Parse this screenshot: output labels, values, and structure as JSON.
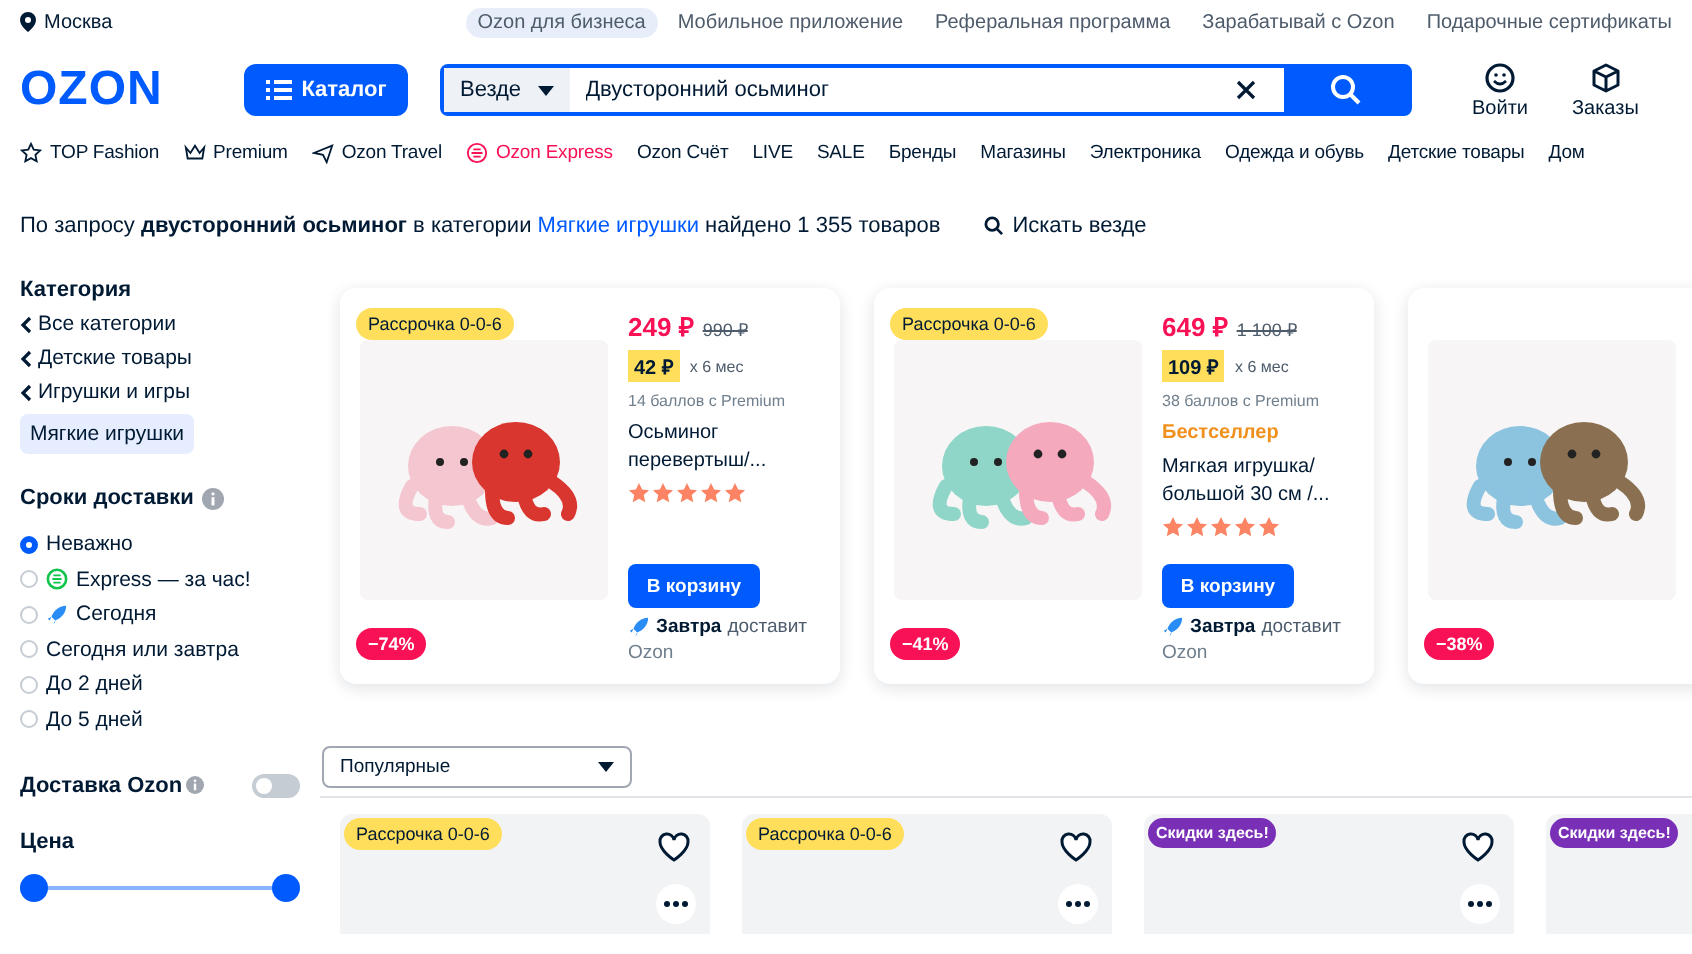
{
  "top_bar": {
    "location": "Москва",
    "links": [
      {
        "label": "Ozon для бизнеса",
        "highlighted": true
      },
      {
        "label": "Мобильное приложение",
        "highlighted": false
      },
      {
        "label": "Реферальная программа",
        "highlighted": false
      },
      {
        "label": "Зарабатывай с Ozon",
        "highlighted": false
      },
      {
        "label": "Подарочные сертификаты",
        "highlighted": false
      }
    ]
  },
  "header": {
    "logo": "OZON",
    "catalog_button": "Каталог",
    "search": {
      "scope": "Везде",
      "value": "Двусторонний осьминог"
    },
    "actions": [
      {
        "kind": "face",
        "label": "Войти"
      },
      {
        "kind": "box",
        "label": "Заказы"
      }
    ]
  },
  "nav": [
    {
      "label": "TOP Fashion",
      "kind": "star"
    },
    {
      "label": "Premium",
      "kind": "crown"
    },
    {
      "label": "Ozon Travel",
      "kind": "plane"
    },
    {
      "label": "Ozon Express",
      "kind": "express"
    },
    {
      "label": "Ozon Счёт",
      "kind": "plain"
    },
    {
      "label": "LIVE",
      "kind": "plain"
    },
    {
      "label": "SALE",
      "kind": "plain"
    },
    {
      "label": "Бренды",
      "kind": "plain"
    },
    {
      "label": "Магазины",
      "kind": "plain"
    },
    {
      "label": "Электроника",
      "kind": "plain"
    },
    {
      "label": "Одежда и обувь",
      "kind": "plain"
    },
    {
      "label": "Детские товары",
      "kind": "plain"
    },
    {
      "label": "Дом",
      "kind": "plain"
    }
  ],
  "query": {
    "prefix": "По запросу **двусторонний осьминог** в категории",
    "link": "Мягкие игрушки",
    "suffix": "найдено 1 355 товаров",
    "search_everywhere": "Искать везде"
  },
  "sidebar": {
    "category_title": "Категория",
    "categories": [
      {
        "label": "Все категории",
        "selected": false
      },
      {
        "label": "Детские товары",
        "selected": false
      },
      {
        "label": "Игрушки и игры",
        "selected": false
      },
      {
        "label": "Мягкие игрушки",
        "selected": true
      }
    ],
    "delivery_title": "Сроки доставки",
    "delivery_options": [
      {
        "label": "Неважно",
        "kind": "plain",
        "selected": true
      },
      {
        "label": "Express — за час!",
        "kind": "express",
        "selected": false
      },
      {
        "label": "Сегодня",
        "kind": "rocket",
        "selected": false
      },
      {
        "label": "Сегодня или завтра",
        "kind": "plain",
        "selected": false
      },
      {
        "label": "До 2 дней",
        "kind": "plain",
        "selected": false
      },
      {
        "label": "До 5 дней",
        "kind": "plain",
        "selected": false
      }
    ],
    "ozon_delivery": {
      "label": "Доставка Ozon",
      "on": false
    },
    "price": {
      "title": "Цена",
      "level": 1
    }
  },
  "products": [
    {
      "badge": "Рассрочка 0-0-6",
      "price": "249 ₽",
      "old_price": "990 ₽",
      "installment": "42 ₽",
      "installment_term": "x 6 мес",
      "points": "14 баллов с Premium",
      "title": "Осьминог перевертыш/...",
      "stars": 5,
      "button": "В корзину",
      "delivery_day": "Завтра",
      "delivery_text": "доставит",
      "seller": "Ozon",
      "discount": "−74%",
      "kind": "pink"
    },
    {
      "badge": "Рассрочка 0-0-6",
      "price": "649 ₽",
      "old_price": "1 100 ₽",
      "installment": "109 ₽",
      "installment_term": "x 6 мес",
      "points": "38 баллов с Premium",
      "label": "Бестселлер",
      "title": "Мягкая игрушка/ большой 30 см /...",
      "stars": 5,
      "button": "В корзину",
      "delivery_day": "Завтра",
      "delivery_text": "доставит",
      "seller": "Ozon",
      "discount": "−41%",
      "kind": "mint"
    },
    {
      "discount": "−38%",
      "kind": "blue"
    }
  ],
  "sort": {
    "value": "Популярные"
  },
  "grid": [
    {
      "badge": "Рассрочка 0-0-6",
      "kind": "installment"
    },
    {
      "badge": "Рассрочка 0-0-6",
      "kind": "installment"
    },
    {
      "badge": "Скидки здесь!",
      "kind": "promo"
    },
    {
      "badge": "Скидки здесь!",
      "kind": "promo"
    }
  ]
}
